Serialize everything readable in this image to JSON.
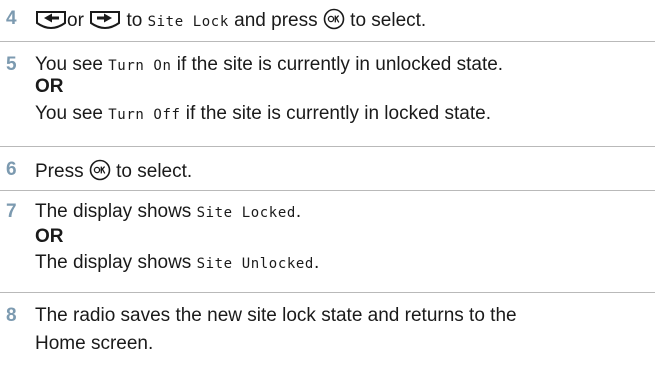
{
  "steps": [
    {
      "number": "4",
      "parts": {
        "or_word": "or",
        "to_word": "to",
        "menu_item": "Site Lock",
        "and_press": "and press",
        "to_select": "to select."
      }
    },
    {
      "number": "5",
      "line1_code": "Turn On",
      "line1_rest": "if the site is currently in unlocked state.",
      "or_label": "OR",
      "line3_pre": "You see",
      "line3_code": "Turn Off",
      "line3_rest": "if the site is currently in locked state.",
      "line1_pre": "You see"
    },
    {
      "number": "6",
      "pre": "Press",
      "post": "to select."
    },
    {
      "number": "7",
      "line1_pre": "The display shows",
      "line1_code": "Site Locked",
      "line1_post": ".",
      "or_label": "OR",
      "line3_pre": "The display shows",
      "line3_code": "Site Unlocked",
      "line3_post": "."
    },
    {
      "number": "8",
      "line1": "The radio saves the new site lock state and returns to the",
      "line2": "Home screen."
    }
  ],
  "icons": {
    "left_key": "left-arrow-key-icon",
    "right_key": "right-arrow-key-icon",
    "ok_key": "ok-button-icon"
  },
  "colors": {
    "step_number": "#7c9ab0",
    "divider": "#b9b9b9",
    "text": "#1a1a1a"
  }
}
